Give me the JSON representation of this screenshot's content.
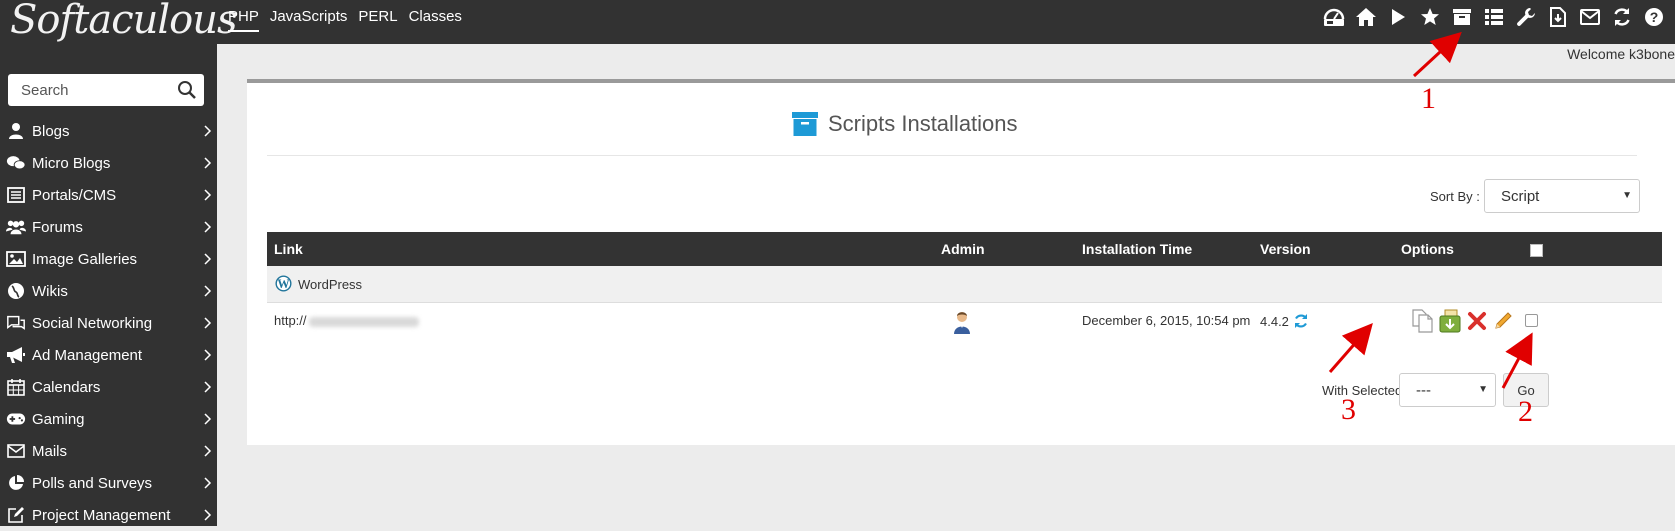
{
  "app": {
    "logo_text": "Softaculous"
  },
  "topnav": {
    "tabs": [
      {
        "label": "PHP",
        "active": true
      },
      {
        "label": "JavaScripts",
        "active": false
      },
      {
        "label": "PERL",
        "active": false
      },
      {
        "label": "Classes",
        "active": false
      }
    ],
    "icons": [
      "dashboard-icon",
      "home-icon",
      "play-icon",
      "star-icon",
      "installations-box-icon",
      "list-icon",
      "wrench-icon",
      "file-download-icon",
      "mail-icon",
      "refresh-icon",
      "help-icon"
    ],
    "welcome": "Welcome k3bone"
  },
  "sidebar": {
    "search_placeholder": "Search",
    "items": [
      {
        "label": "Blogs",
        "icon": "user-icon"
      },
      {
        "label": "Micro Blogs",
        "icon": "chat-icon"
      },
      {
        "label": "Portals/CMS",
        "icon": "list-box-icon"
      },
      {
        "label": "Forums",
        "icon": "users-icon"
      },
      {
        "label": "Image Galleries",
        "icon": "image-icon"
      },
      {
        "label": "Wikis",
        "icon": "globe-icon"
      },
      {
        "label": "Social Networking",
        "icon": "comments-icon"
      },
      {
        "label": "Ad Management",
        "icon": "bullhorn-icon"
      },
      {
        "label": "Calendars",
        "icon": "calendar-icon"
      },
      {
        "label": "Gaming",
        "icon": "gamepad-icon"
      },
      {
        "label": "Mails",
        "icon": "envelope-icon"
      },
      {
        "label": "Polls and Surveys",
        "icon": "pie-chart-icon"
      },
      {
        "label": "Project Management",
        "icon": "edit-icon"
      }
    ]
  },
  "main": {
    "title": "Scripts Installations",
    "sort_label": "Sort By :",
    "sort_value": "Script",
    "table": {
      "headers": {
        "link": "Link",
        "admin": "Admin",
        "time": "Installation Time",
        "version": "Version",
        "options": "Options"
      },
      "group": "WordPress",
      "rows": [
        {
          "link_prefix": "http://",
          "link_rest_blurred": true,
          "time": "December 6, 2015, 10:54 pm",
          "version": "4.4.2"
        }
      ]
    },
    "with_selected_label": "With Selected:",
    "with_selected_value": "---",
    "go_label": "Go"
  },
  "annotations": {
    "one": "1",
    "two": "2",
    "three": "3"
  },
  "colors": {
    "topbar": "#323232",
    "accent_blue": "#1e9ad6",
    "annotation_red": "#e00000",
    "delete_red": "#d9302c"
  }
}
